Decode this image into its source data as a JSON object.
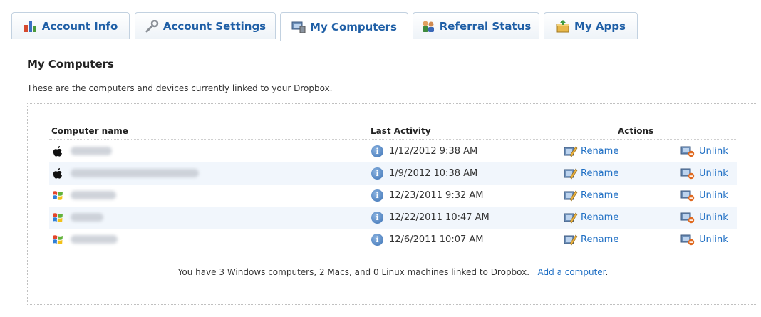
{
  "tabs": [
    {
      "label": "Account Info",
      "icon": "bar-chart-icon"
    },
    {
      "label": "Account Settings",
      "icon": "wrench-icon"
    },
    {
      "label": "My Computers",
      "icon": "computer-icon",
      "active": true
    },
    {
      "label": "Referral Status",
      "icon": "people-icon"
    },
    {
      "label": "My Apps",
      "icon": "app-box-icon"
    }
  ],
  "page": {
    "title": "My Computers",
    "description": "These are the computers and devices currently linked to your Dropbox."
  },
  "table": {
    "headers": {
      "name": "Computer name",
      "activity": "Last Activity",
      "actions": "Actions"
    },
    "rows": [
      {
        "os": "apple-icon",
        "name": "atomicmac",
        "last_activity": "1/12/2012 9:38 AM",
        "rename": "Rename",
        "unlink": "Unlink"
      },
      {
        "os": "apple-icon",
        "name": "mac-voxelap.ot.fraunhofer.de",
        "last_activity": "1/9/2012 10:38 AM",
        "rename": "Rename",
        "unlink": "Unlink"
      },
      {
        "os": "windows-icon",
        "name": "pc-hanslap",
        "last_activity": "12/23/2011 9:32 AM",
        "rename": "Rename",
        "unlink": "Unlink"
      },
      {
        "os": "windows-icon",
        "name": "vm-hanz",
        "last_activity": "12/22/2011 10:47 AM",
        "rename": "Rename",
        "unlink": "Unlink"
      },
      {
        "os": "windows-icon",
        "name": "pc-hahnlap",
        "last_activity": "12/6/2011 10:07 AM",
        "rename": "Rename",
        "unlink": "Unlink"
      }
    ]
  },
  "summary": {
    "text": "You have 3 Windows computers, 2 Macs, and 0 Linux machines linked to Dropbox.",
    "add_link": "Add a computer"
  },
  "colors": {
    "link": "#1f6fc4",
    "tab_text": "#1f5fa6",
    "row_alt": "#f1f6fc"
  }
}
